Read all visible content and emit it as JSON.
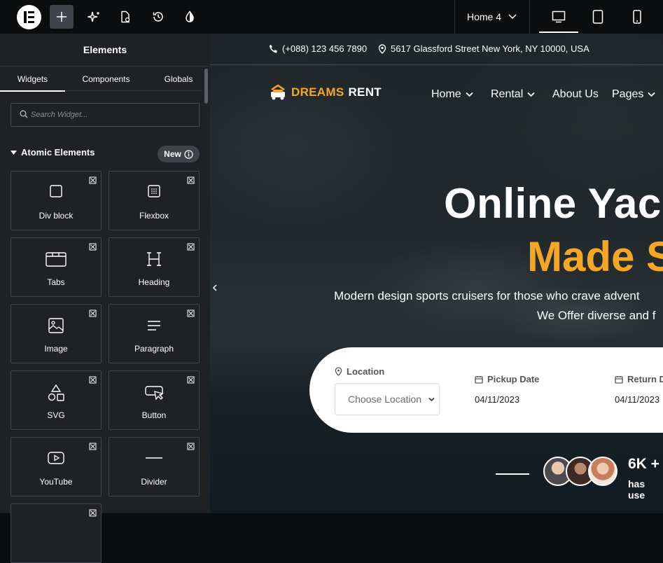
{
  "topbar": {
    "page_selector": "Home 4"
  },
  "panel": {
    "title": "Elements",
    "tabs": [
      "Widgets",
      "Components",
      "Globals"
    ],
    "search_placeholder": "Search Widget...",
    "section_title": "Atomic Elements",
    "new_badge": "New",
    "widgets": [
      {
        "label": "Div block",
        "icon": "div-block-icon"
      },
      {
        "label": "Flexbox",
        "icon": "flexbox-icon"
      },
      {
        "label": "Tabs",
        "icon": "tabs-icon"
      },
      {
        "label": "Heading",
        "icon": "heading-icon"
      },
      {
        "label": "Image",
        "icon": "image-icon"
      },
      {
        "label": "Paragraph",
        "icon": "paragraph-icon"
      },
      {
        "label": "SVG",
        "icon": "svg-shapes-icon"
      },
      {
        "label": "Button",
        "icon": "button-icon"
      },
      {
        "label": "YouTube",
        "icon": "youtube-icon"
      },
      {
        "label": "Divider",
        "icon": "divider-icon"
      }
    ]
  },
  "site": {
    "phone": "(+088) 123 456 7890",
    "address": "5617 Glassford Street New York, NY 10000, USA",
    "brand_part1": "DREAMS",
    "brand_part2": "RENT",
    "nav": [
      "Home",
      "Rental",
      "About Us",
      "Pages"
    ],
    "hero_line1": "Online Yach",
    "hero_line2": "Made S",
    "hero_sub1": "Modern design sports cruisers for those who crave advent",
    "hero_sub2": "We Offer diverse and f",
    "booking": {
      "location_label": "Location",
      "location_value": "Choose Location",
      "pickup_label": "Pickup Date",
      "pickup_value": "04/11/2023",
      "return_label": "Return D",
      "return_value": "04/11/2023"
    },
    "stat_value": "6K +",
    "stat_label": "has use"
  },
  "colors": {
    "accent": "#f5a623",
    "panel_bg": "#1f2124",
    "topbar_bg": "#0c0d0e"
  }
}
